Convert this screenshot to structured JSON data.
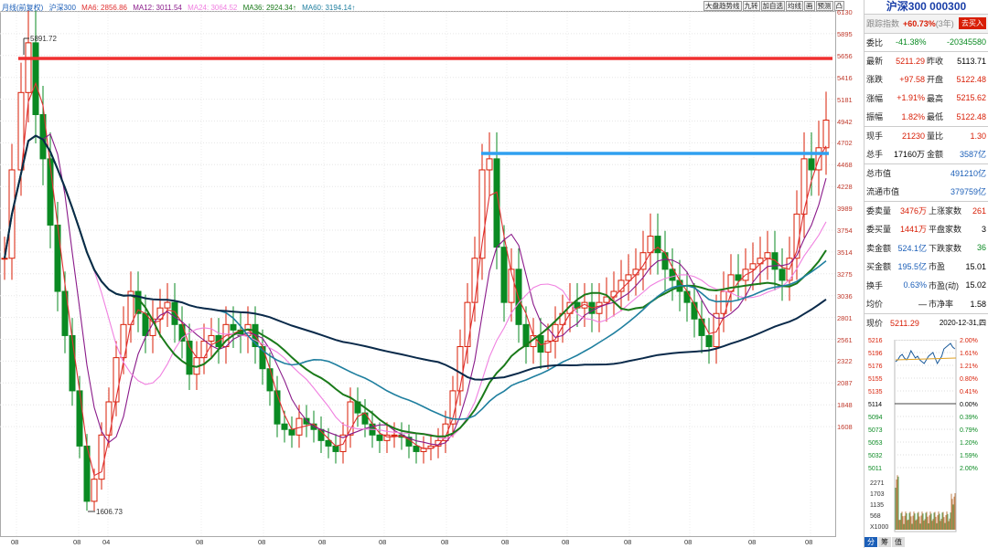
{
  "header": {
    "mode": "月线(前复权)",
    "symbol": "沪深300",
    "ma6": "MA6: 2856.86",
    "ma12": "MA12: 3011.54",
    "ma24": "MA24: 3064.52",
    "ma36": "MA36: 2924.34↑",
    "ma60": "MA60: 3194.14↑"
  },
  "toolbar": [
    "大盘趋势线",
    "九转",
    "加自选",
    "均线",
    "画",
    "预测",
    "凸"
  ],
  "y_ticks": [
    "6130",
    "5895",
    "5656",
    "5416",
    "5181",
    "4942",
    "4702",
    "4468",
    "4228",
    "3989",
    "3754",
    "3514",
    "3275",
    "3036",
    "2801",
    "2561",
    "2322",
    "2087",
    "1848",
    "1608"
  ],
  "x_ticks": [
    "08",
    "08",
    "04",
    "08",
    "08",
    "08",
    "08",
    "08",
    "08",
    "08",
    "08",
    "08",
    "08",
    "08"
  ],
  "annotations": {
    "high": "5891.72",
    "low": "1606.73"
  },
  "colors": {
    "up": "#d81e06",
    "down": "#0a8a22",
    "hline_red": "#f03030",
    "hline_blue": "#30a0f0",
    "ma6": "#e03030",
    "ma12": "#8a1a8a",
    "ma24": "#f080e0",
    "ma36": "#1a7a1a",
    "ma60": "#1f7f9f",
    "ma120": "#0a2a4a"
  },
  "panel": {
    "title": "沪深300 000300",
    "track_label": "跟踪指数",
    "track_value": "+60.73%",
    "track_period": "(3年)",
    "buy_button": "去买入",
    "weibi_label": "委比",
    "weibi_value": "-41.38%",
    "weibi_amount": "-20345580",
    "latest_label": "最新",
    "latest_value": "5211.29",
    "prevclose_label": "昨收",
    "prevclose_value": "5113.71",
    "change_label": "涨跌",
    "change_value": "+97.58",
    "open_label": "开盘",
    "open_value": "5122.48",
    "pct_label": "涨幅",
    "pct_value": "+1.91%",
    "high_label": "最高",
    "high_value": "5215.62",
    "amp_label": "振幅",
    "amp_value": "1.82%",
    "low_label": "最低",
    "low_value": "5122.48",
    "now_label": "现手",
    "now_value": "21230",
    "volratio_label": "量比",
    "volratio_value": "1.30",
    "total_label": "总手",
    "total_value": "17160万",
    "amount_label": "金额",
    "amount_value": "3587亿",
    "mcap_label": "总市值",
    "mcap_value": "491210亿",
    "float_label": "流通市值",
    "float_value": "379759亿",
    "sellvol_label": "委卖量",
    "sellvol_value": "3476万",
    "upcount_label": "上涨家数",
    "upcount_value": "261",
    "buyvol_label": "委买量",
    "buyvol_value": "1441万",
    "flatcount_label": "平盘家数",
    "flatcount_value": "3",
    "sellamt_label": "卖金额",
    "sellamt_value": "524.1亿",
    "downcount_label": "下跌家数",
    "downcount_value": "36",
    "buyamt_label": "买金额",
    "buyamt_value": "195.5亿",
    "pe_label": "市盈",
    "pe_value": "15.01",
    "turnover_label": "换手",
    "turnover_value": "0.63%",
    "pedyn_label": "市盈(动)",
    "pedyn_value": "15.02",
    "avg_label": "均价",
    "avg_value": "—",
    "pb_label": "市净率",
    "pb_value": "1.58",
    "price_label": "现价",
    "price_value": "5211.29",
    "date_value": "2020-12-31,四",
    "mini_left": [
      "5216",
      "5196",
      "5176",
      "5155",
      "5135",
      "5114",
      "5094",
      "5073",
      "5053",
      "5032",
      "5011"
    ],
    "mini_right": [
      "2.00%",
      "1.61%",
      "1.21%",
      "0.80%",
      "0.41%",
      "0.00%",
      "0.39%",
      "0.79%",
      "1.20%",
      "1.59%",
      "2.00%"
    ],
    "vol_ticks": [
      "2271",
      "1703",
      "1135",
      "568",
      "X1000"
    ],
    "tabs": [
      "分",
      "筹",
      "值"
    ]
  }
}
